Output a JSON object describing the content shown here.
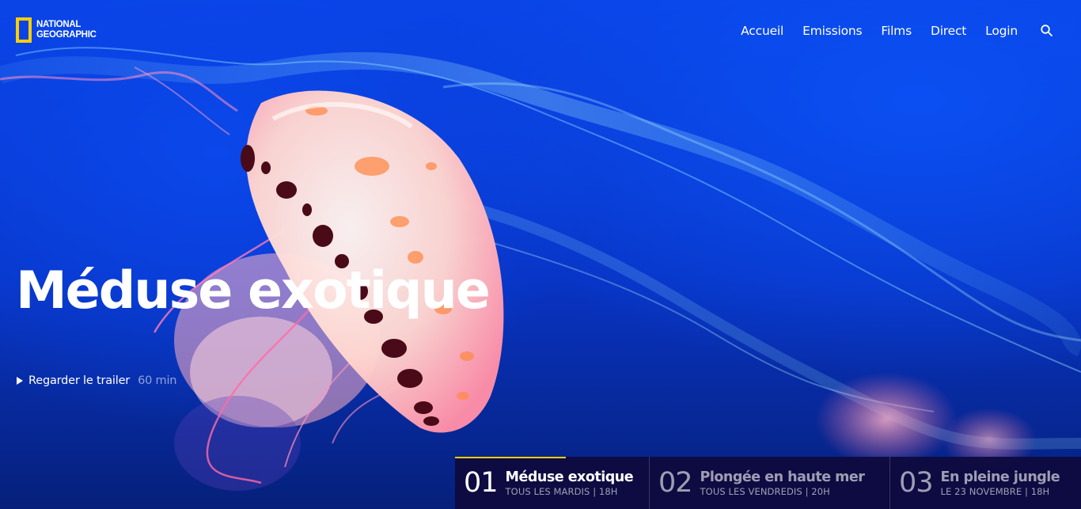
{
  "brand": {
    "line1": "NATIONAL",
    "line2": "GEOGRAPHIC",
    "frame_color": "#ffce00"
  },
  "nav": {
    "items": [
      {
        "label": "Accueil"
      },
      {
        "label": "Emissions"
      },
      {
        "label": "Films"
      },
      {
        "label": "Direct"
      },
      {
        "label": "Login"
      }
    ],
    "search_icon": "search-icon"
  },
  "hero": {
    "title": "Méduse exotique",
    "trailer_label": "Regarder le trailer",
    "duration": "60 min",
    "play_icon": "play-icon"
  },
  "schedule": [
    {
      "number": "01",
      "title": "Méduse exotique",
      "subtitle": "TOUS LES MARDIS | 18H",
      "active": true
    },
    {
      "number": "02",
      "title": "Plongée en haute mer",
      "subtitle": "TOUS LES VENDREDIS | 20H",
      "active": false
    },
    {
      "number": "03",
      "title": "En pleine jungle",
      "subtitle": "LE 23 NOVEMBRE | 18H",
      "active": false
    }
  ],
  "colors": {
    "accent": "#ffce00",
    "water": "#0a43e6",
    "strip": "#0e0a3c"
  }
}
